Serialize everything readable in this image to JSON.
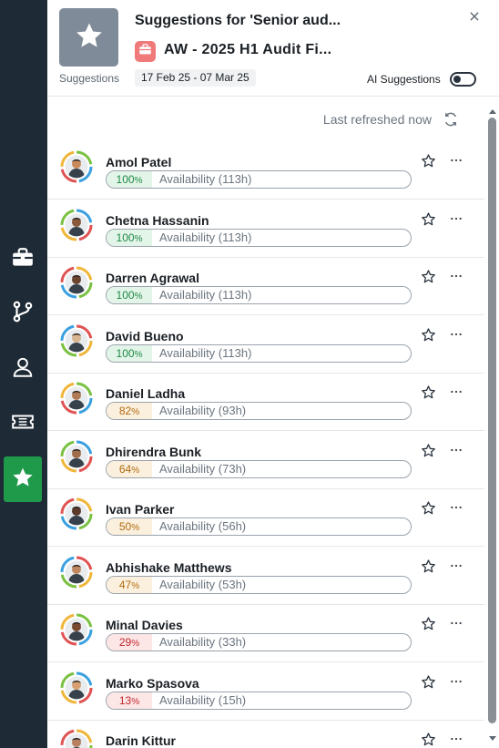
{
  "rail": {
    "items": [
      {
        "name": "briefcase-icon",
        "active": false
      },
      {
        "name": "branch-icon",
        "active": false
      },
      {
        "name": "person-icon",
        "active": false
      },
      {
        "name": "ticket-icon",
        "active": false
      },
      {
        "name": "star-icon",
        "active": true
      }
    ],
    "active_color": "#1f9a4b"
  },
  "header": {
    "tile_caption": "Suggestions",
    "title": "Suggestions for 'Senior aud...",
    "project_title": "AW - 2025 H1 Audit Fi...",
    "date_range": "17 Feb 25 - 07 Mar 25",
    "ai_suggestions_label": "AI Suggestions",
    "ai_suggestions_on": false
  },
  "refresh": {
    "text": "Last refreshed now"
  },
  "people": [
    {
      "name": "Amol Patel",
      "percent": "100",
      "availability": "Availability (113h)",
      "level": "green"
    },
    {
      "name": "Chetna Hassanin",
      "percent": "100",
      "availability": "Availability (113h)",
      "level": "green"
    },
    {
      "name": "Darren Agrawal",
      "percent": "100",
      "availability": "Availability (113h)",
      "level": "green"
    },
    {
      "name": "David Bueno",
      "percent": "100",
      "availability": "Availability (113h)",
      "level": "green"
    },
    {
      "name": "Daniel Ladha",
      "percent": "82",
      "availability": "Availability (93h)",
      "level": "orange"
    },
    {
      "name": "Dhirendra Bunk",
      "percent": "64",
      "availability": "Availability (73h)",
      "level": "orange"
    },
    {
      "name": "Ivan Parker",
      "percent": "50",
      "availability": "Availability (56h)",
      "level": "orange"
    },
    {
      "name": "Abhishake Matthews",
      "percent": "47",
      "availability": "Availability (53h)",
      "level": "orange"
    },
    {
      "name": "Minal Davies",
      "percent": "29",
      "availability": "Availability (33h)",
      "level": "red"
    },
    {
      "name": "Marko Spasova",
      "percent": "13",
      "availability": "Availability (15h)",
      "level": "red"
    },
    {
      "name": "Darin Kittur",
      "percent": "",
      "availability": "",
      "level": "green"
    }
  ],
  "colors": {
    "rail_bg": "#1e2a36",
    "tile_bg": "#7f8b98",
    "project_icon": "#f07a7a",
    "green": "#1c8a45",
    "orange": "#b06a10",
    "red": "#c4282f"
  }
}
